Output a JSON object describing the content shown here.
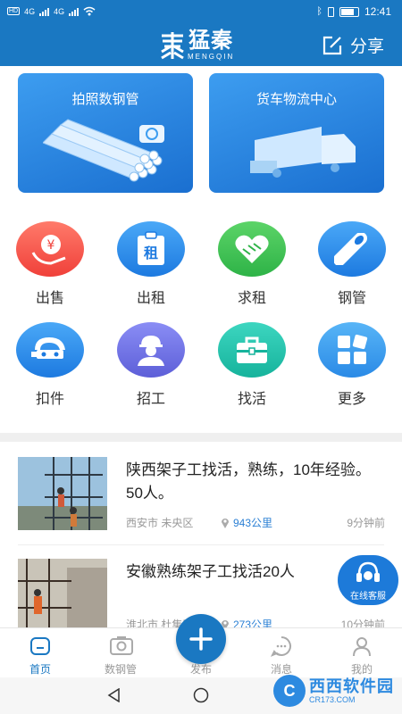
{
  "status": {
    "network": "4G",
    "time": "12:41"
  },
  "header": {
    "logo_cn": "猛秦",
    "logo_en": "MENGQIN",
    "share_label": "分享"
  },
  "banners": [
    {
      "title": "拍照数钢管"
    },
    {
      "title": "货车物流中心"
    }
  ],
  "grid": [
    {
      "label": "出售",
      "icon": "sell-yuan-icon",
      "glyph": "¥"
    },
    {
      "label": "出租",
      "icon": "rent-icon",
      "glyph": "租"
    },
    {
      "label": "求租",
      "icon": "handshake-icon"
    },
    {
      "label": "钢管",
      "icon": "pipe-icon"
    },
    {
      "label": "扣件",
      "icon": "clamp-icon"
    },
    {
      "label": "招工",
      "icon": "worker-icon"
    },
    {
      "label": "找活",
      "icon": "toolbox-icon"
    },
    {
      "label": "更多",
      "icon": "more-grid-icon"
    }
  ],
  "posts": [
    {
      "title": "陕西架子工找活，熟练，10年经验。50人。",
      "location": "西安市 未央区",
      "distance": "943公里",
      "time": "9分钟前"
    },
    {
      "title": "安徽熟练架子工找活20人",
      "location": "淮北市 杜集区",
      "distance": "273公里",
      "time": "10分钟前"
    }
  ],
  "service": {
    "label": "在线客服"
  },
  "nav": [
    {
      "label": "首页",
      "icon": "home-icon",
      "active": true
    },
    {
      "label": "数钢管",
      "icon": "camera-icon"
    },
    {
      "label": "发布",
      "icon": "plus-icon"
    },
    {
      "label": "消息",
      "icon": "message-icon"
    },
    {
      "label": "我的",
      "icon": "user-icon"
    }
  ],
  "watermark": {
    "logo": "C",
    "name": "西西软件园",
    "url": "CR173.COM"
  },
  "colors": {
    "brand": "#1a78c2",
    "accent_text": "#2a7fd4"
  }
}
